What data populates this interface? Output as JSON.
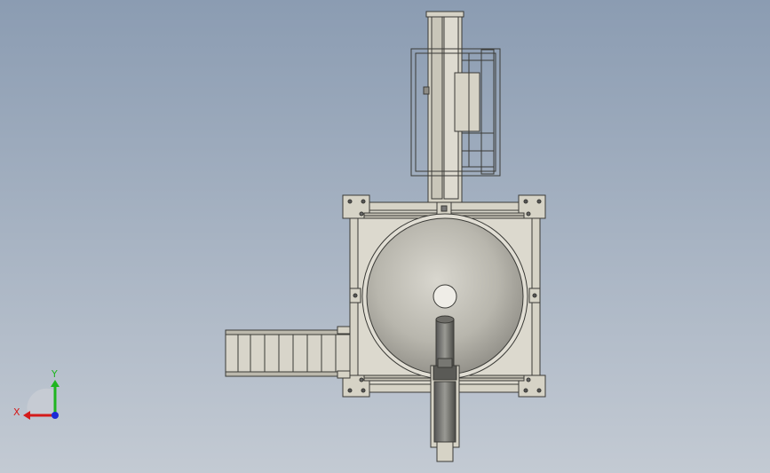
{
  "viewport": {
    "background_top": "#8b9cb2",
    "background_bottom": "#c3cad3"
  },
  "model": {
    "fill_color": "#d6d3c6",
    "edge_color": "#3a3a36",
    "bowl_color": "#b9b7ad"
  },
  "triad": {
    "x_label": "X",
    "y_label": "Y",
    "x_color": "#d41a1a",
    "y_color": "#1fb51f",
    "z_color": "#1c2ad6",
    "icons": [
      "axis-triad-icon"
    ]
  }
}
